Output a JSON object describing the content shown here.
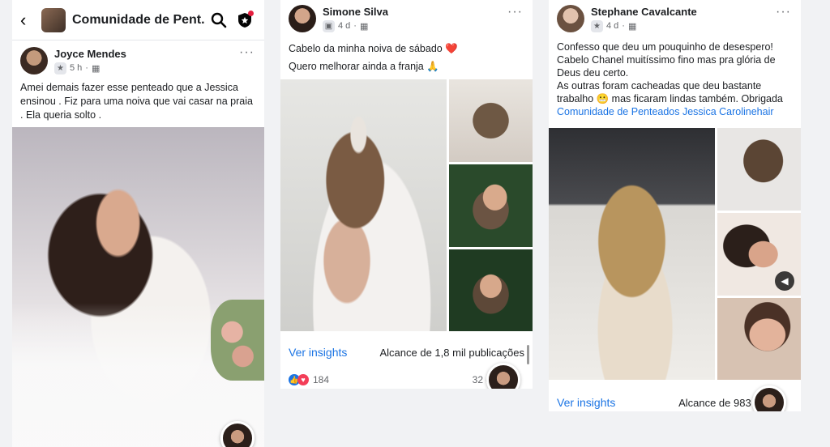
{
  "group": {
    "title": "Comunidade de Pent...",
    "back_glyph": "‹"
  },
  "posts": [
    {
      "author": "Joyce Mendes",
      "time": "5 h",
      "text": "Amei demais fazer esse penteado que a Jessica ensinou . Fiz para uma noiva que vai casar na praia . Ela queria solto ."
    },
    {
      "author": "Simone Silva",
      "time": "4 d",
      "text_line1": "Cabelo da minha noiva de sábado ❤️",
      "text_line2": "Quero melhorar ainda a franja 🙏",
      "insights": "Ver insights",
      "reach": "Alcance de 1,8 mil publicações",
      "reactions": "184",
      "comments": "32 co"
    },
    {
      "author": "Stephane Cavalcante",
      "time": "4 d",
      "text_line1": "Confesso que deu um pouquinho de desespero! Cabelo Chanel muitíssimo fino mas pra glória de Deus deu certo.",
      "text_line2": "As outras foram cacheadas que deu bastante trabalho 😬 mas ficaram lindas também. Obrigada",
      "link": "Comunidade de Penteados Jessica Carolinehair",
      "insights": "Ver insights",
      "reach": "Alcance de 983 pub"
    }
  ],
  "meta_sep": "·",
  "more_glyph": "···"
}
